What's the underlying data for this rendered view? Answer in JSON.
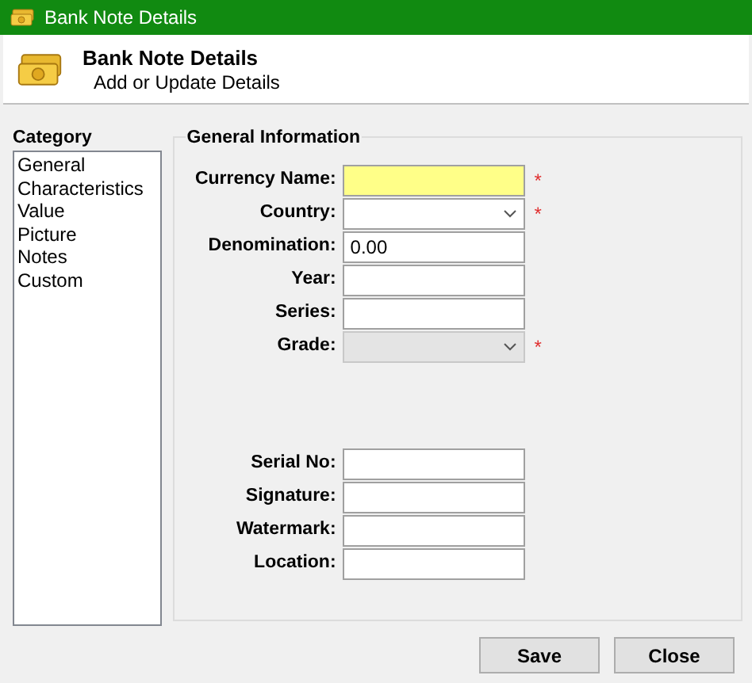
{
  "window": {
    "title": "Bank Note Details"
  },
  "header": {
    "title": "Bank Note Details",
    "subtitle": "Add or Update Details"
  },
  "category": {
    "label": "Category",
    "items": [
      "General",
      "Characteristics",
      "Value",
      "Picture",
      "Notes",
      "Custom"
    ]
  },
  "general_information": {
    "title": "General Information",
    "fields": [
      {
        "label": "Currency Name:",
        "kind": "text",
        "required_mark": "*",
        "highlighted": true,
        "disabled": false
      },
      {
        "label": "Country:",
        "kind": "select",
        "required_mark": "*",
        "highlighted": false,
        "disabled": false
      },
      {
        "label": "Denomination:",
        "kind": "text",
        "value": "0.00",
        "highlighted": false,
        "disabled": false
      },
      {
        "label": "Year:",
        "kind": "text",
        "highlighted": false,
        "disabled": false
      },
      {
        "label": "Series:",
        "kind": "text",
        "highlighted": false,
        "disabled": false
      },
      {
        "label": "Grade:",
        "kind": "select",
        "required_mark": "*",
        "highlighted": false,
        "disabled": true
      }
    ],
    "more_fields": [
      {
        "label": "Serial No:",
        "kind": "text",
        "highlighted": false,
        "disabled": false
      },
      {
        "label": "Signature:",
        "kind": "text",
        "highlighted": false,
        "disabled": false
      },
      {
        "label": "Watermark:",
        "kind": "text",
        "highlighted": false,
        "disabled": false
      },
      {
        "label": "Location:",
        "kind": "text",
        "highlighted": false,
        "disabled": false
      }
    ]
  },
  "buttons": [
    "Save",
    "Close"
  ]
}
